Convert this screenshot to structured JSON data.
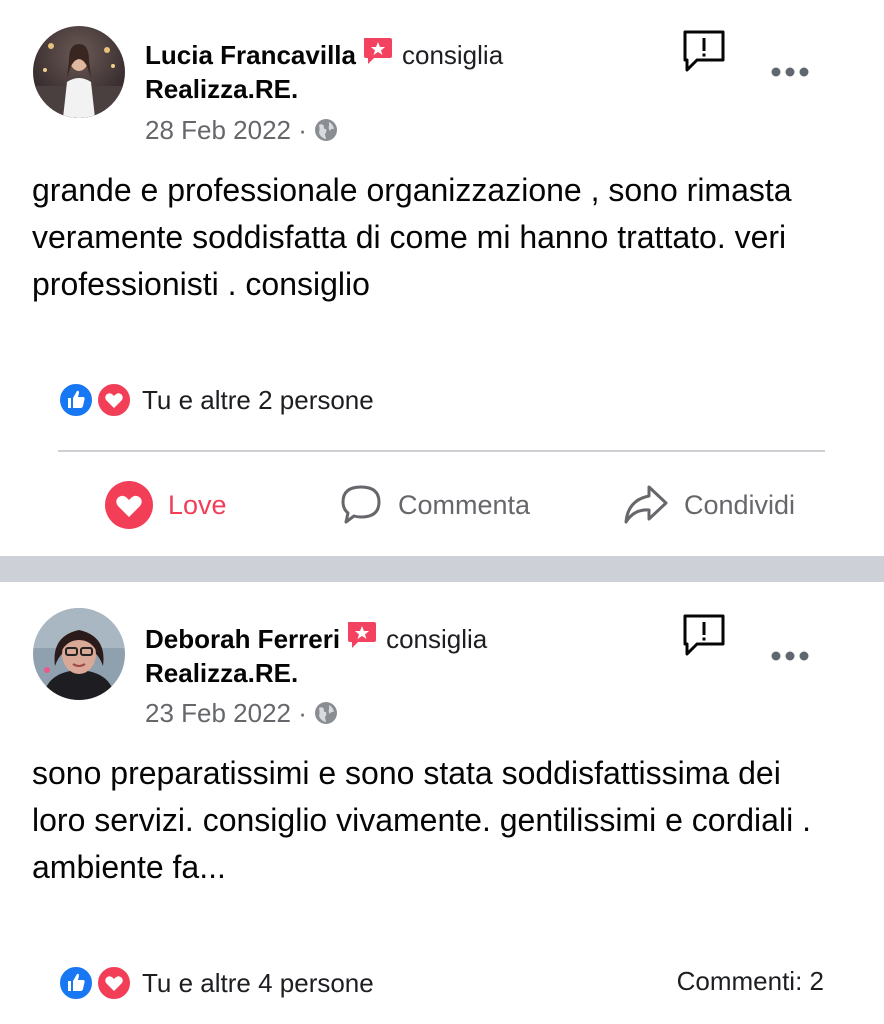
{
  "posts": [
    {
      "author": "Lucia Francavilla",
      "recommend_text": "consiglia",
      "page": "Realizza.RE.",
      "date": "28 Feb 2022 ·",
      "body": "grande e professionale organizzazione , sono rimasta veramente soddisfatta di come mi hanno trattato. veri professionisti . consiglio",
      "reactions_text": "Tu e altre 2 persone",
      "actions": {
        "love": "Love",
        "comment": "Commenta",
        "share": "Condividi"
      }
    },
    {
      "author": "Deborah Ferreri",
      "recommend_text": "consiglia",
      "page": "Realizza.RE.",
      "date": "23 Feb 2022 ·",
      "body": "sono preparatissimi e sono stata soddisfattissima dei loro servizi. consiglio vivamente. gentilissimi e cordiali . ambiente fa...",
      "reactions_text": "Tu e altre 4 persone",
      "comments_count": "Commenti: 2"
    }
  ],
  "icons": {
    "recommend": "recommend-badge-icon",
    "report": "report-icon",
    "more": "more-options-icon",
    "globe": "globe-icon",
    "like": "like-reaction-icon",
    "love": "love-reaction-icon",
    "comment": "comment-icon",
    "share": "share-icon"
  },
  "colors": {
    "love_red": "#f33e58",
    "like_blue": "#1877f2",
    "recommend_red": "#f3425f",
    "meta_gray": "#65676b",
    "separator": "#cdd0d6"
  }
}
